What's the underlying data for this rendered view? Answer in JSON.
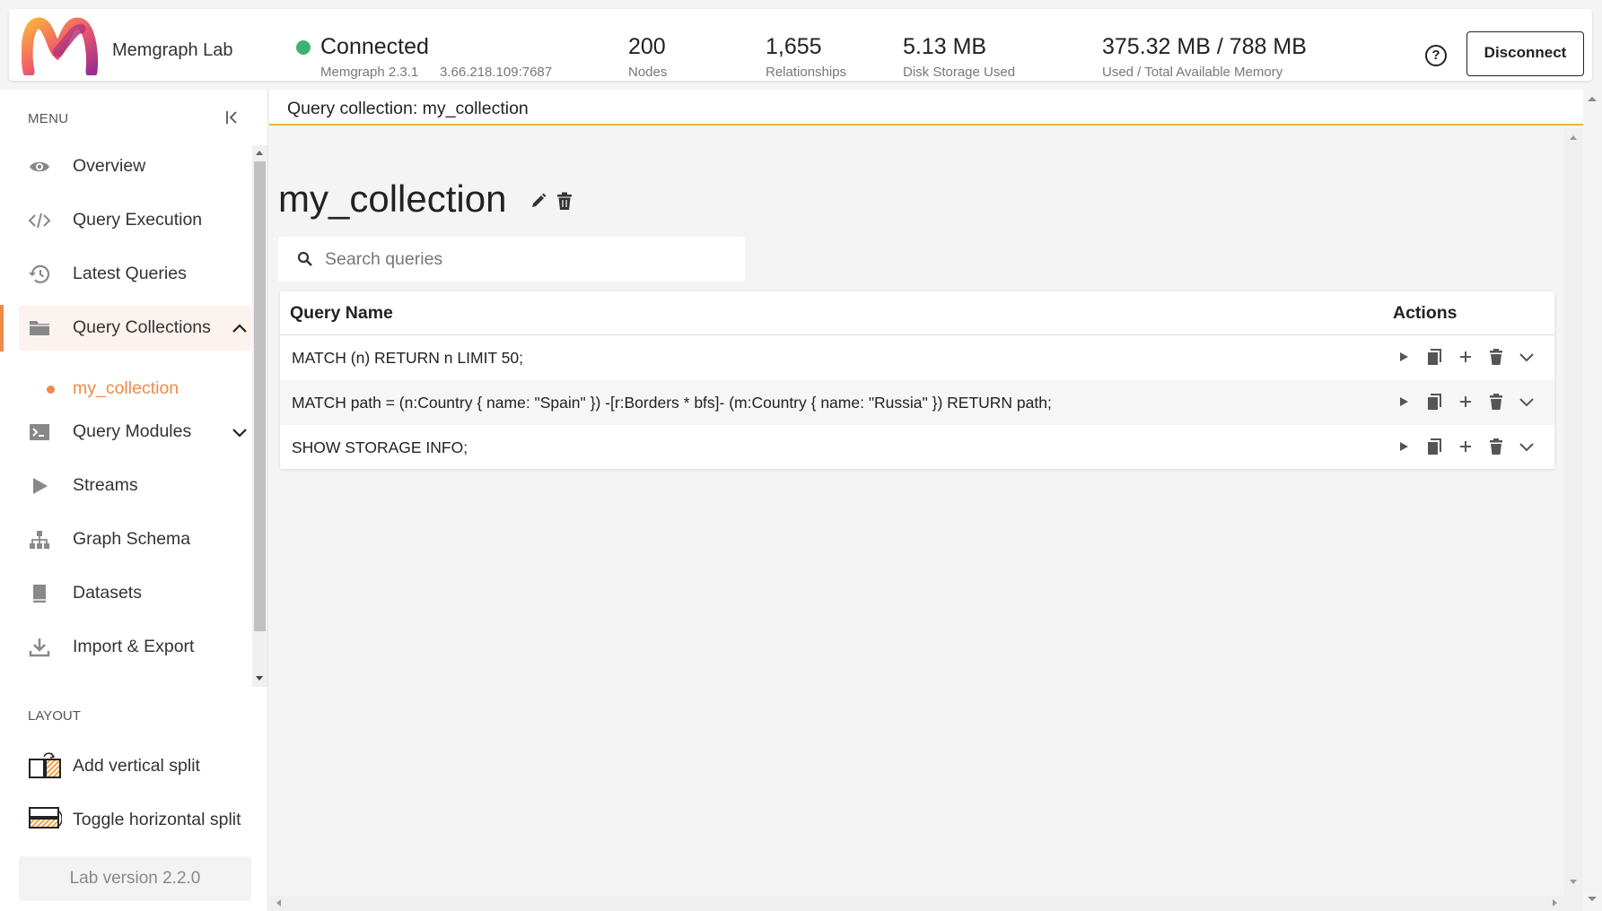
{
  "header": {
    "app_title": "Memgraph Lab",
    "status": "Connected",
    "version": "Memgraph 2.3.1",
    "address": "3.66.218.109:7687",
    "stats": [
      {
        "value": "200",
        "label": "Nodes"
      },
      {
        "value": "1,655",
        "label": "Relationships"
      },
      {
        "value": "5.13 MB",
        "label": "Disk Storage Used"
      },
      {
        "value": "375.32 MB / 788 MB",
        "label": "Used / Total Available Memory"
      }
    ],
    "disconnect_label": "Disconnect",
    "status_color": "#3bb56b"
  },
  "sidebar": {
    "menu_title": "MENU",
    "items": [
      {
        "label": "Overview",
        "icon": "eye-icon"
      },
      {
        "label": "Query Execution",
        "icon": "code-icon"
      },
      {
        "label": "Latest Queries",
        "icon": "history-icon"
      },
      {
        "label": "Query Collections",
        "icon": "folder-icon",
        "active": true,
        "expanded": true
      },
      {
        "label": "Query Modules",
        "icon": "terminal-icon",
        "expanded": false
      },
      {
        "label": "Streams",
        "icon": "play-icon"
      },
      {
        "label": "Graph Schema",
        "icon": "schema-icon"
      },
      {
        "label": "Datasets",
        "icon": "book-icon"
      },
      {
        "label": "Import & Export",
        "icon": "download-icon"
      }
    ],
    "sub_item": "my_collection",
    "layout_title": "LAYOUT",
    "layout_items": [
      {
        "label": "Add vertical split",
        "icon": "vertical-split-icon"
      },
      {
        "label": "Toggle horizontal split",
        "icon": "horizontal-split-icon"
      }
    ],
    "version": "Lab version 2.2.0",
    "accent_color": "#f08a47"
  },
  "main": {
    "panel_title": "Query collection: my_collection",
    "collection_name": "my_collection",
    "search_placeholder": "Search queries",
    "table": {
      "columns": [
        "Query Name",
        "Actions"
      ],
      "rows": [
        "MATCH (n) RETURN n LIMIT 50;",
        "MATCH path = (n:Country { name: \"Spain\" }) -[r:Borders * bfs]- (m:Country { name: \"Russia\" }) RETURN path;",
        "SHOW STORAGE INFO;"
      ],
      "actions": [
        "run-icon",
        "copy-icon",
        "add-icon",
        "trash-icon",
        "expand-icon"
      ]
    },
    "tab_underline_color": "#f0b13f"
  }
}
